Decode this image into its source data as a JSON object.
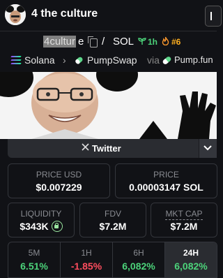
{
  "header": {
    "title": "4 the culture"
  },
  "token": {
    "symbol_selected": "4cultur",
    "symbol_rest": "e",
    "separator": "/",
    "quote": "SOL",
    "age": "1h",
    "rank": "#6"
  },
  "chain": {
    "name": "Solana",
    "dex": "PumpSwap",
    "via": "via",
    "launchpad": "Pump.fun"
  },
  "social": {
    "twitter_label": "Twitter"
  },
  "stats": {
    "price_usd": {
      "label": "PRICE USD",
      "value": "$0.007229"
    },
    "price_sol": {
      "label": "PRICE",
      "value": "0.00003147 SOL"
    },
    "liquidity": {
      "label": "LIQUIDITY",
      "value": "$343K"
    },
    "fdv": {
      "label": "FDV",
      "value": "$7.2M"
    },
    "mkt_cap": {
      "label": "MKT CAP",
      "value": "$7.2M"
    }
  },
  "timeframes": [
    {
      "label": "5M",
      "value": "6.51%",
      "color": "#4cd37a"
    },
    {
      "label": "1H",
      "value": "-1.85%",
      "color": "#ff4d5e"
    },
    {
      "label": "6H",
      "value": "6,082%",
      "color": "#4cd37a"
    },
    {
      "label": "24H",
      "value": "6,082%",
      "color": "#4cd37a"
    }
  ],
  "colors": {
    "positive": "#4cd37a",
    "negative": "#ff4d5e",
    "accent": "#ffb020"
  }
}
